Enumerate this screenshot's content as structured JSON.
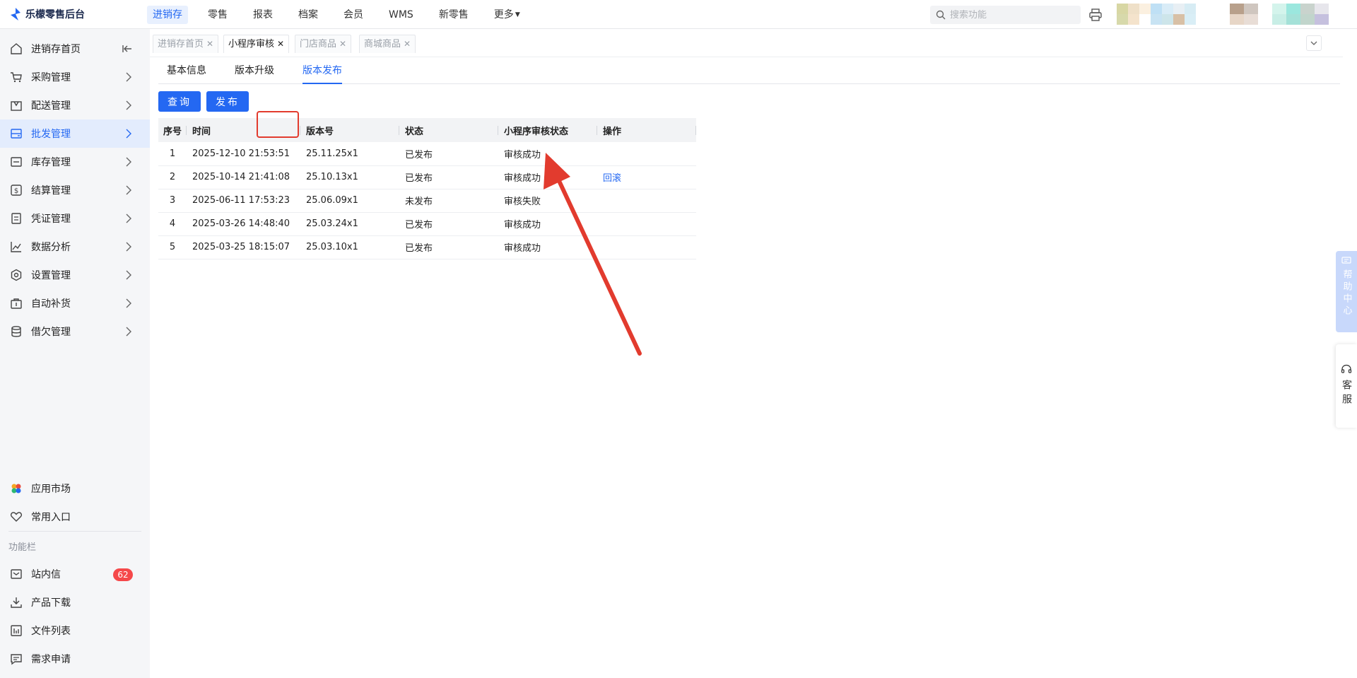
{
  "app": {
    "title": "乐檬零售后台"
  },
  "topnav": [
    {
      "label": "进销存",
      "active": true
    },
    {
      "label": "零售"
    },
    {
      "label": "报表"
    },
    {
      "label": "档案"
    },
    {
      "label": "会员"
    },
    {
      "label": "WMS"
    },
    {
      "label": "新零售"
    },
    {
      "label": "更多"
    }
  ],
  "search": {
    "placeholder": "搜索功能"
  },
  "sidebar": {
    "items": [
      {
        "label": "进销存首页"
      },
      {
        "label": "采购管理"
      },
      {
        "label": "配送管理"
      },
      {
        "label": "批发管理",
        "active": true
      },
      {
        "label": "库存管理"
      },
      {
        "label": "结算管理"
      },
      {
        "label": "凭证管理"
      },
      {
        "label": "数据分析"
      },
      {
        "label": "设置管理"
      },
      {
        "label": "自动补货"
      },
      {
        "label": "借欠管理"
      }
    ],
    "bottom": [
      {
        "label": "应用市场"
      },
      {
        "label": "常用入口"
      }
    ],
    "section_label": "功能栏",
    "tools": [
      {
        "label": "站内信",
        "badge": "62"
      },
      {
        "label": "产品下载"
      },
      {
        "label": "文件列表"
      },
      {
        "label": "需求申请"
      }
    ]
  },
  "page_tabs": [
    {
      "label": "进销存首页"
    },
    {
      "label": "小程序审核",
      "active": true
    },
    {
      "label": "门店商品"
    },
    {
      "label": "商城商品"
    }
  ],
  "sub_tabs": [
    {
      "label": "基本信息"
    },
    {
      "label": "版本升级"
    },
    {
      "label": "版本发布",
      "active": true
    }
  ],
  "buttons": {
    "query": "查询",
    "publish": "发布"
  },
  "table": {
    "headers": [
      "序号",
      "时间",
      "版本号",
      "状态",
      "小程序审核状态",
      "操作"
    ],
    "rows": [
      {
        "no": "1",
        "time": "2025-12-10 21:53:51",
        "version": "25.11.25x1",
        "status": "已发布",
        "review": "审核成功",
        "action": ""
      },
      {
        "no": "2",
        "time": "2025-10-14 21:41:08",
        "version": "25.10.13x1",
        "status": "已发布",
        "review": "审核成功",
        "action": "回滚"
      },
      {
        "no": "3",
        "time": "2025-06-11 17:53:23",
        "version": "25.06.09x1",
        "status": "未发布",
        "review": "审核失败",
        "action": ""
      },
      {
        "no": "4",
        "time": "2025-03-26 14:48:40",
        "version": "25.03.24x1",
        "status": "已发布",
        "review": "审核成功",
        "action": ""
      },
      {
        "no": "5",
        "time": "2025-03-25 18:15:07",
        "version": "25.03.10x1",
        "status": "已发布",
        "review": "审核成功",
        "action": ""
      }
    ]
  },
  "float": {
    "help": "帮助中心",
    "service": "客服"
  },
  "colors": {
    "accent": "#2468f2",
    "annotation": "#e23b2e",
    "badge": "#f5484a"
  }
}
